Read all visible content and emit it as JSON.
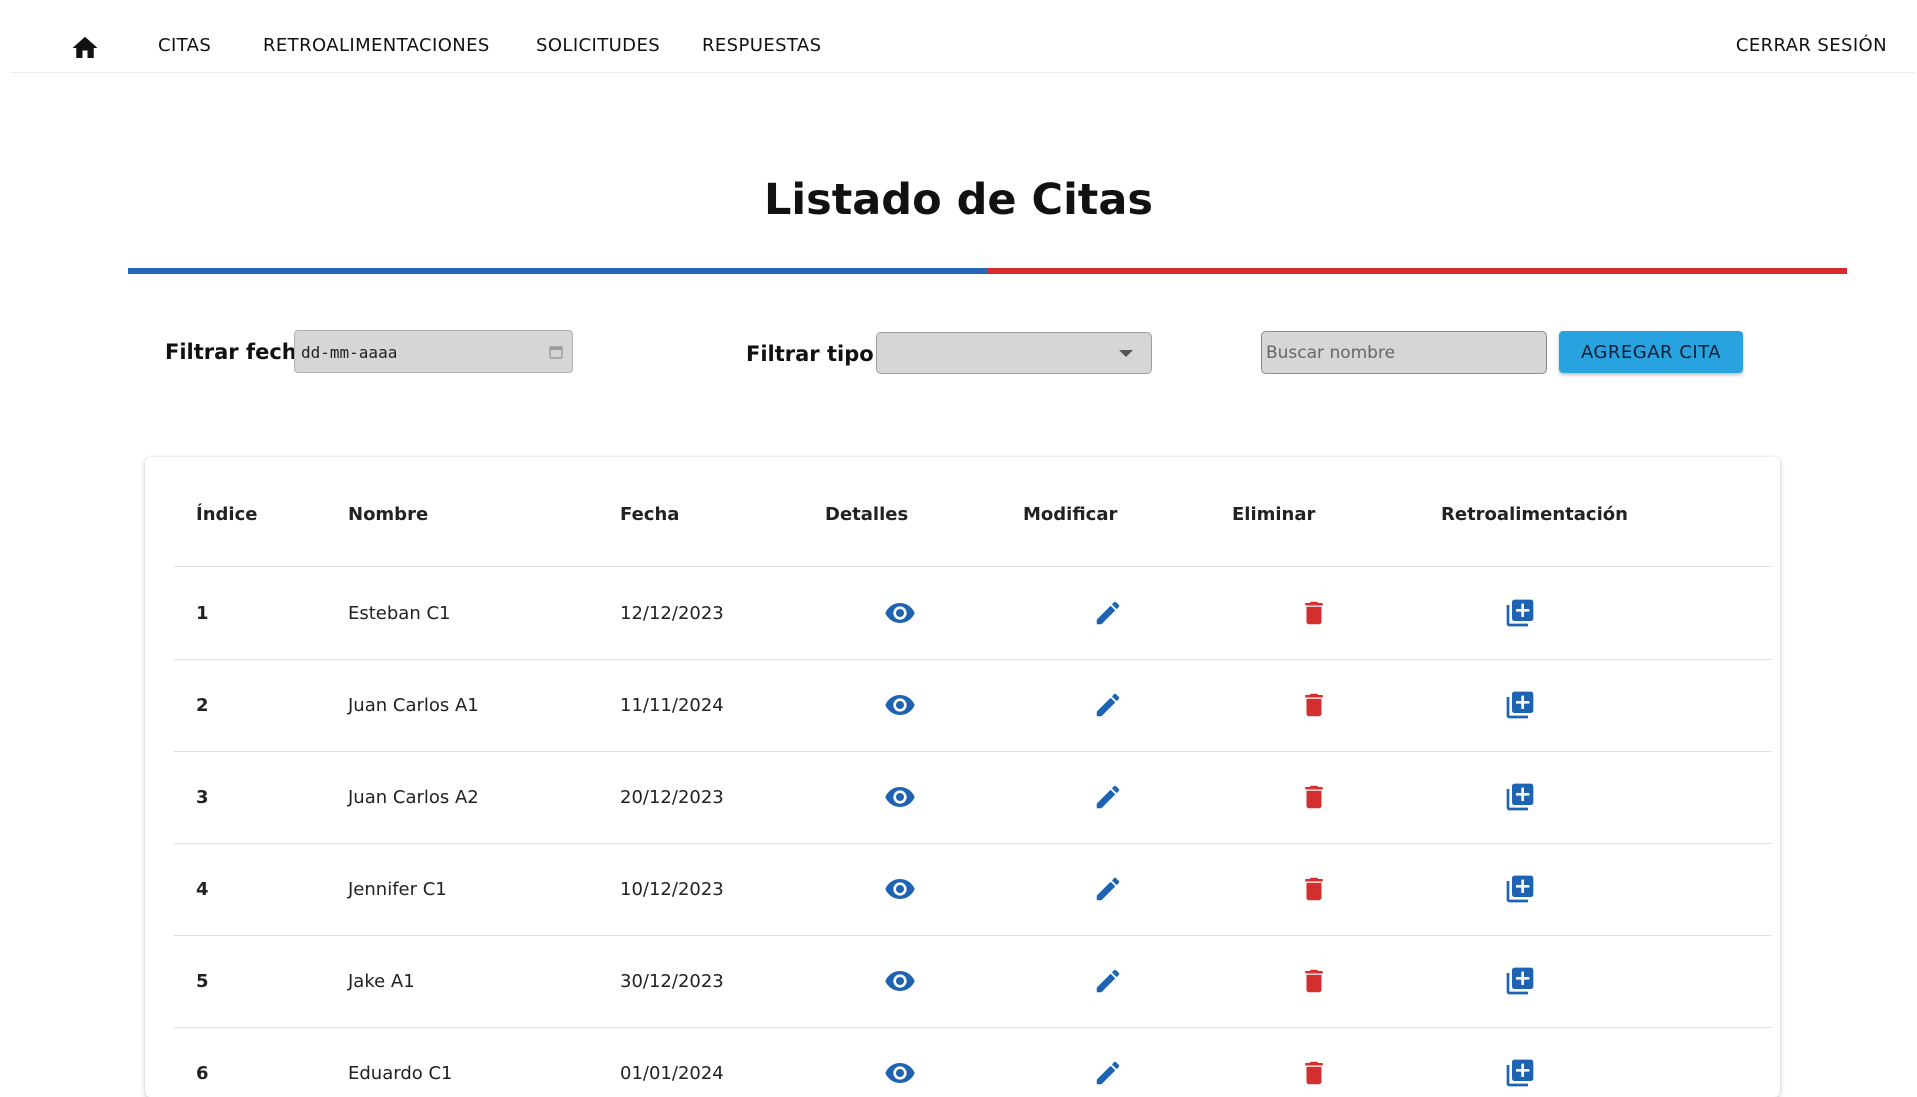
{
  "colors": {
    "primary_blue": "#1e63b2",
    "divider_blue": "#2566b8",
    "divider_red": "#d62a2e",
    "delete_red": "#d32f2f",
    "button_bg": "#29a3e0"
  },
  "nav": {
    "home_icon": "home-icon",
    "items": [
      "CITAS",
      "RETROALIMENTACIONES",
      "SOLICITUDES",
      "RESPUESTAS"
    ],
    "logout": "CERRAR SESIÓN"
  },
  "page": {
    "title": "Listado de Citas"
  },
  "filters": {
    "date_label": "Filtrar fecha:",
    "date_placeholder": "dd-mm-aaaa",
    "type_label": "Filtrar tipo:",
    "type_value": "",
    "search_placeholder": "Buscar nombre",
    "add_button": "AGREGAR CITA"
  },
  "table": {
    "headers": [
      "Índice",
      "Nombre",
      "Fecha",
      "Detalles",
      "Modificar",
      "Eliminar",
      "Retroalimentación"
    ],
    "rows": [
      {
        "index": "1",
        "name": "Esteban C1",
        "date": "12/12/2023"
      },
      {
        "index": "2",
        "name": "Juan Carlos A1",
        "date": "11/11/2024"
      },
      {
        "index": "3",
        "name": "Juan Carlos A2",
        "date": "20/12/2023"
      },
      {
        "index": "4",
        "name": "Jennifer C1",
        "date": "10/12/2023"
      },
      {
        "index": "5",
        "name": "Jake A1",
        "date": "30/12/2023"
      },
      {
        "index": "6",
        "name": "Eduardo C1",
        "date": "01/01/2024"
      }
    ]
  }
}
